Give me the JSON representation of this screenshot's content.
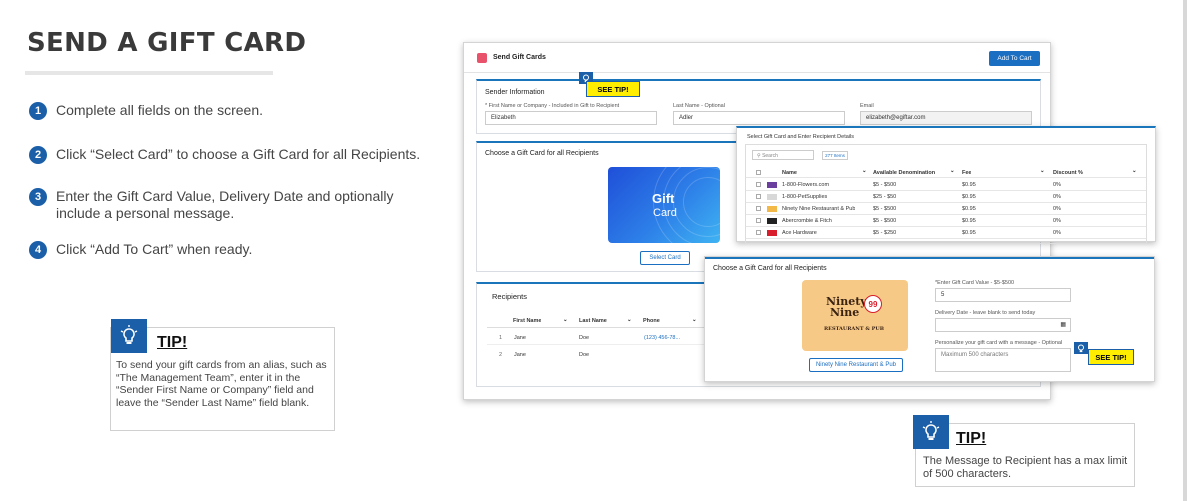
{
  "title": "SEND A GIFT CARD",
  "steps": [
    {
      "num": "1",
      "text": "Complete all fields on the screen."
    },
    {
      "num": "2",
      "text": "Click “Select Card” to choose a Gift Card for all Recipients."
    },
    {
      "num": "3",
      "text": "Enter the Gift Card Value, Delivery Date and optionally\ninclude a personal message."
    },
    {
      "num": "4",
      "text": "Click “Add To Cart” when ready."
    }
  ],
  "tip1": {
    "title": "TIP!",
    "text": "To send your gift cards from an alias, such as “The Management Team”, enter it in the “Sender First Name or Company” field and leave the “Sender Last Name” field blank."
  },
  "tip2": {
    "title": "TIP!",
    "text": "The Message to Recipient has a max limit of 500 characters."
  },
  "see_tip": "SEE TIP!",
  "app": {
    "header_title": "Send Gift Cards",
    "add_to_cart": "Add To Cart",
    "sender": {
      "title": "Sender Information",
      "first_label": "* First Name or Company - Included in Gift to Recipient",
      "first_value": "Elizabeth",
      "last_label": "Last Name - Optional",
      "last_value": "Adler",
      "email_label": "Email",
      "email_value": "elizabeth@egiftar.com"
    },
    "choose_title": "Choose a Gift Card for all Recipients",
    "gift_card_line1": "Gift",
    "gift_card_line2": "Card",
    "select_card": "Select Card",
    "recipients": {
      "title": "Recipients",
      "columns": [
        "First Name",
        "Last Name",
        "Phone"
      ],
      "rows": [
        {
          "num": "1",
          "first": "Jane",
          "last": "Doe",
          "phone": "(123) 456-78..."
        },
        {
          "num": "2",
          "first": "Jane",
          "last": "Doe",
          "phone": ""
        }
      ]
    },
    "select_dialog": {
      "title": "Select Gift Card and Enter Recipient Details",
      "search_placeholder": "Search",
      "count": "277 Items",
      "columns": [
        "Name",
        "Available Denomination",
        "Fee",
        "Discount %"
      ],
      "rows": [
        {
          "name": "1-800-Flowers.com",
          "denom": "$5 - $500",
          "fee": "$0.95",
          "discount": "0%"
        },
        {
          "name": "1-800-PetSupplies",
          "denom": "$25 - $50",
          "fee": "$0.95",
          "discount": "0%"
        },
        {
          "name": "Ninety Nine Restaurant & Pub",
          "denom": "$5 - $500",
          "fee": "$0.95",
          "discount": "0%"
        },
        {
          "name": "Abercrombie & Fitch",
          "denom": "$5 - $500",
          "fee": "$0.95",
          "discount": "0%"
        },
        {
          "name": "Ace Hardware",
          "denom": "$5 - $250",
          "fee": "$0.95",
          "discount": "0%"
        }
      ]
    },
    "chosen": {
      "title": "Choose a Gift Card for all Recipients",
      "brand_line1": "Ninety",
      "brand_line2": "Nine",
      "brand_badge": "99",
      "brand_line3": "RESTAURANT & PUB",
      "brand_button": "Ninety Nine Restaurant & Pub",
      "value_label": "*Enter Gift Card Value - $5-$500",
      "value": "5",
      "date_label": "Delivery Date - leave blank to send today",
      "message_label": "Personalize your gift card with a message - Optional",
      "message_placeholder": "Maximum 500 characters"
    }
  },
  "colors": {
    "accent": "#1a5fa8",
    "highlight": "#ffee00",
    "link": "#1b6fc2"
  }
}
